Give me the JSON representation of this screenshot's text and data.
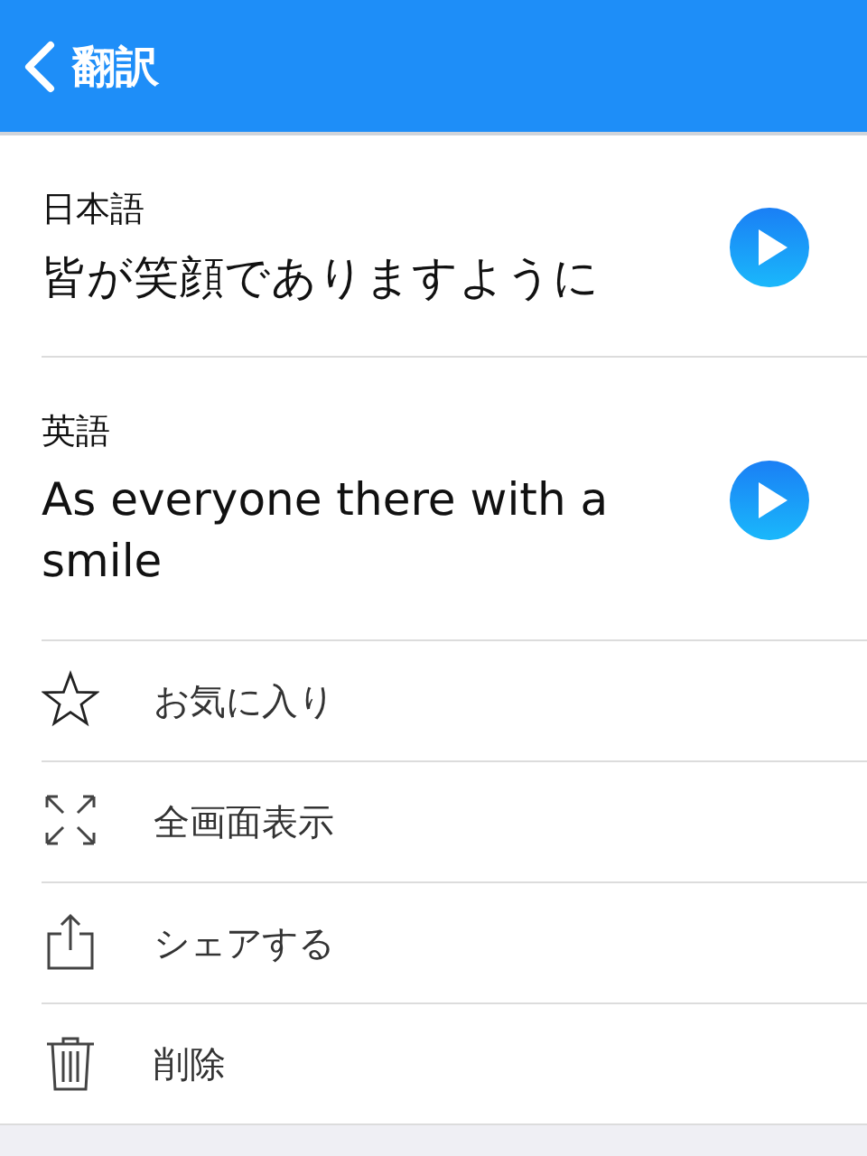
{
  "header": {
    "title": "翻訳"
  },
  "translations": [
    {
      "language": "日本語",
      "text": "皆が笑顔でありますように"
    },
    {
      "language": "英語",
      "text": "As everyone there with a smile"
    }
  ],
  "actions": [
    {
      "kind": "star",
      "label": "お気に入り"
    },
    {
      "kind": "expand",
      "label": "全画面表示"
    },
    {
      "kind": "share",
      "label": "シェアする"
    },
    {
      "kind": "trash",
      "label": "削除"
    }
  ]
}
